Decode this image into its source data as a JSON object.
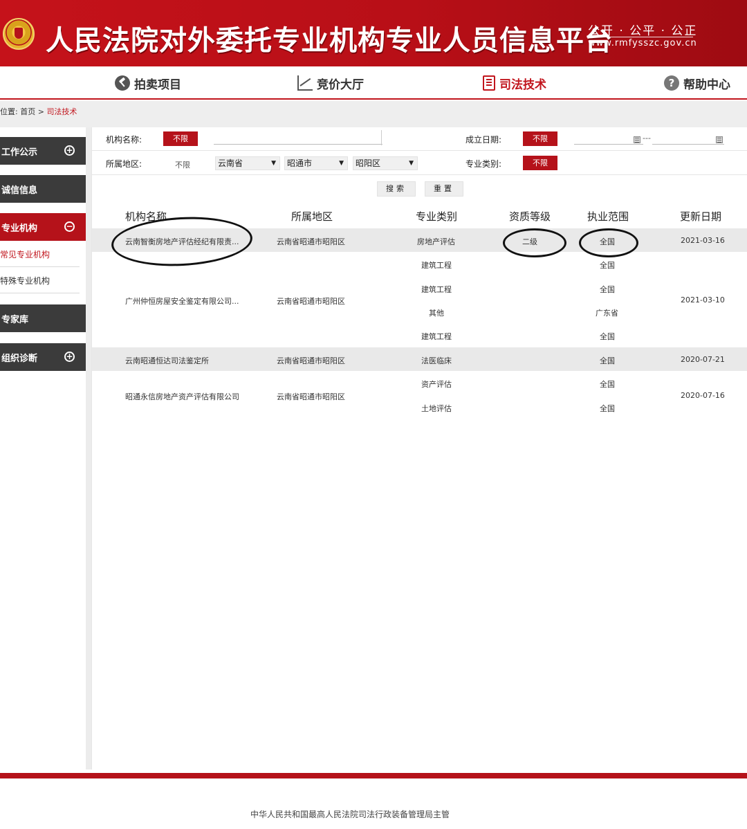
{
  "header": {
    "title": "人民法院对外委托专业机构专业人员信息平台",
    "slogan": "公开 · 公平 · 公正",
    "domain": "www.rmfysszc.gov.cn"
  },
  "nav": {
    "items": [
      {
        "label": "拍卖项目",
        "icon": "gavel-icon"
      },
      {
        "label": "竞价大厅",
        "icon": "trend-chart-icon"
      },
      {
        "label": "司法技术",
        "icon": "book-icon"
      },
      {
        "label": "帮助中心",
        "icon": "help-icon"
      }
    ],
    "active": "司法技术"
  },
  "breadcrumb": {
    "prefix": "位置:",
    "home": "首页",
    "sep": ">",
    "current": "司法技术"
  },
  "sidebar": {
    "work_notice": "工作公示",
    "integrity": "诚信信息",
    "institutions": "专业机构",
    "common_institutions": "常见专业机构",
    "special_institutions": "特殊专业机构",
    "experts": "专家库",
    "org_diagnosis": "组织诊断"
  },
  "filters": {
    "name_label": "机构名称:",
    "name_tag": "不限",
    "name_value": "",
    "date_label": "成立日期:",
    "date_tag": "不限",
    "date_sep": "---",
    "region_label": "所属地区:",
    "region_plain": "不限",
    "province": "云南省",
    "city": "昭通市",
    "district": "昭阳区",
    "category_label": "专业类别:",
    "category_tag": "不限",
    "dropdown_arrow": "▼"
  },
  "buttons": {
    "search": "搜索",
    "reset": "重置"
  },
  "table": {
    "headers": [
      "机构名称",
      "所属地区",
      "专业类别",
      "资质等级",
      "执业范围",
      "更新日期"
    ],
    "rows": [
      {
        "name": "云南智衡房地产评估经纪有限责...",
        "region": "云南省昭通市昭阳区",
        "date": "2021-03-16",
        "items": [
          {
            "category": "房地产评估",
            "grade": "二级",
            "scope": "全国"
          }
        ]
      },
      {
        "name": "广州仲恒房屋安全鉴定有限公司...",
        "region": "云南省昭通市昭阳区",
        "date": "2021-03-10",
        "items": [
          {
            "category": "建筑工程",
            "grade": "",
            "scope": "全国"
          },
          {
            "category": "建筑工程",
            "grade": "",
            "scope": "全国"
          },
          {
            "category": "其他",
            "grade": "",
            "scope": "广东省"
          },
          {
            "category": "建筑工程",
            "grade": "",
            "scope": "全国"
          }
        ]
      },
      {
        "name": "云南昭通恒达司法鉴定所",
        "region": "云南省昭通市昭阳区",
        "date": "2020-07-21",
        "items": [
          {
            "category": "法医临床",
            "grade": "",
            "scope": "全国"
          }
        ]
      },
      {
        "name": "昭通永信房地产资产评估有限公司",
        "region": "云南省昭通市昭阳区",
        "date": "2020-07-16",
        "items": [
          {
            "category": "资产评估",
            "grade": "",
            "scope": "全国"
          },
          {
            "category": "土地评估",
            "grade": "",
            "scope": "全国"
          }
        ]
      }
    ]
  },
  "footer": {
    "text": "中华人民共和国最高人民法院司法行政装备管理局主管"
  }
}
